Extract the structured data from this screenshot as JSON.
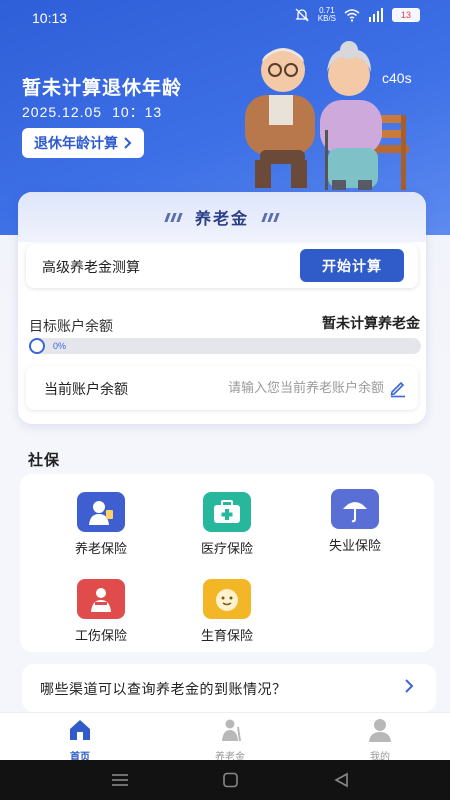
{
  "status_bar": {
    "time": "10:13",
    "net_speed_value": "0.71",
    "net_speed_unit": "KB/S",
    "battery": "13"
  },
  "hero": {
    "title": "暂未计算退休年龄",
    "date": "2025.12.05",
    "time": "10：13",
    "retire_button_label": "退休年龄计算",
    "code": "c40s"
  },
  "pension": {
    "card_title": "养老金",
    "calc_label": "高级养老金测算",
    "calc_button": "开始计算",
    "target_label": "目标账户余额",
    "target_value": "暂未计算养老金",
    "progress_text": "0%",
    "progress": 0,
    "balance_label": "当前账户余额",
    "balance_placeholder": "请输入您当前养老账户余额"
  },
  "social": {
    "section_title": "社保",
    "items": [
      {
        "label": "养老保险",
        "color": "#3f5fd0"
      },
      {
        "label": "医疗保险",
        "color": "#27b79c"
      },
      {
        "label": "失业保险",
        "color": "#5a6fd6"
      },
      {
        "label": "工伤保险",
        "color": "#e04b4b"
      },
      {
        "label": "生育保险",
        "color": "#f2b626"
      }
    ]
  },
  "faq": {
    "question": "哪些渠道可以查询养老金的到账情况？"
  },
  "tabbar": {
    "tabs": [
      {
        "label": "首页",
        "active": true
      },
      {
        "label": "养老金",
        "active": false
      },
      {
        "label": "我的",
        "active": false
      }
    ]
  },
  "colors": {
    "primary": "#2f5cc9",
    "hero_bg": "#3d6fe6",
    "page_bg": "#f5f6fb"
  }
}
